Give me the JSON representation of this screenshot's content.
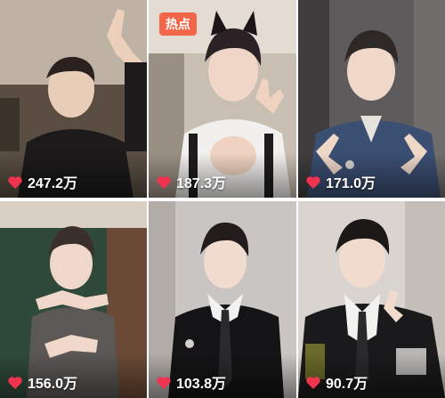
{
  "colors": {
    "like_heart": "#f0334e",
    "hot_badge": "#f2674a",
    "label_text": "#ffffff"
  },
  "icons": {
    "like": "heart-icon"
  },
  "videos": [
    {
      "likes": "247.2万",
      "badge": ""
    },
    {
      "likes": "187.3万",
      "badge": "热点"
    },
    {
      "likes": "171.0万",
      "badge": ""
    },
    {
      "likes": "156.0万",
      "badge": ""
    },
    {
      "likes": "103.8万",
      "badge": ""
    },
    {
      "likes": "90.7万",
      "badge": ""
    }
  ]
}
